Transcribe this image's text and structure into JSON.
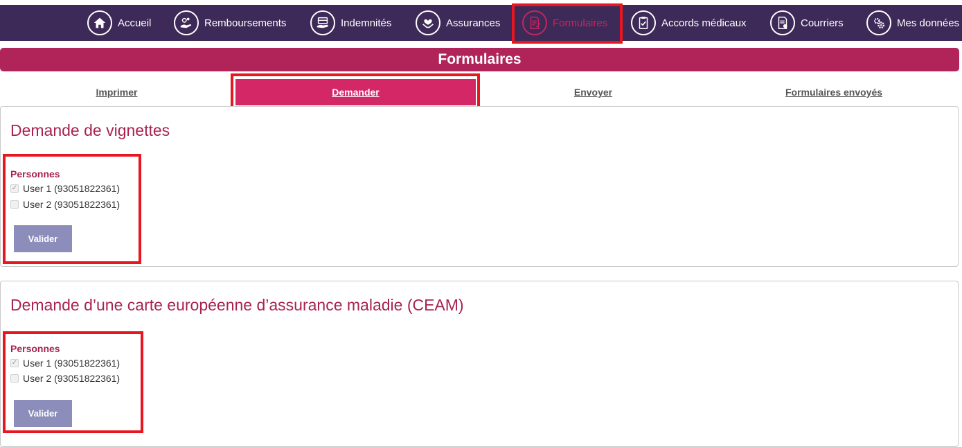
{
  "nav": {
    "items": [
      {
        "label": "Accueil",
        "icon": "home-icon"
      },
      {
        "label": "Remboursements",
        "icon": "refund-icon"
      },
      {
        "label": "Indemnités",
        "icon": "payment-icon"
      },
      {
        "label": "Assurances",
        "icon": "insurance-icon"
      },
      {
        "label": "Formulaires",
        "icon": "form-icon",
        "active": true
      },
      {
        "label": "Accords médicaux",
        "icon": "clipboard-check-icon"
      },
      {
        "label": "Courriers",
        "icon": "letter-icon"
      },
      {
        "label": "Mes données",
        "icon": "gears-icon"
      }
    ]
  },
  "page": {
    "title": "Formulaires"
  },
  "tabs": [
    {
      "label": "Imprimer"
    },
    {
      "label": "Demander",
      "active": true
    },
    {
      "label": "Envoyer"
    },
    {
      "label": "Formulaires envoyés"
    }
  ],
  "sections": [
    {
      "title": "Demande de vignettes",
      "persons_label": "Personnes",
      "persons": [
        {
          "label": "User 1 (93051822361)",
          "checked": true
        },
        {
          "label": "User 2 (93051822361)",
          "checked": false
        }
      ],
      "button": "Valider"
    },
    {
      "title": "Demande d’une carte européenne d’assurance maladie (CEAM)",
      "persons_label": "Personnes",
      "persons": [
        {
          "label": "User 1 (93051822361)",
          "checked": true
        },
        {
          "label": "User 2 (93051822361)",
          "checked": false
        }
      ],
      "button": "Valider"
    }
  ],
  "colors": {
    "nav_bg": "#3e2a58",
    "accent": "#b0245a",
    "active_tab": "#d42766",
    "button": "#8c8dbb",
    "highlight": "#e8161f"
  }
}
